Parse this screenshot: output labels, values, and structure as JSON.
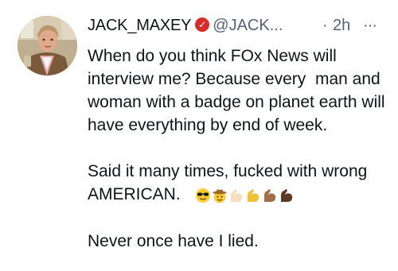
{
  "tweet": {
    "display_name": "JACK_MAXEY",
    "badge_glyph": "✓",
    "handle": "@JACK...",
    "dot": "·",
    "time": "2h",
    "more": "···",
    "paragraph_1": "When do you think FOx News will interview me? Because every  man and woman with a badge on planet earth will have everything by end of week.",
    "paragraph_2": "Said it many times, fucked with wrong AMERICAN.",
    "paragraph_3": "Never once have I lied.",
    "emojis": [
      "smiling-face-with-sunglasses",
      "cowboy-hat-face",
      "flexed-biceps-light",
      "flexed-biceps-medium",
      "flexed-biceps-medium-dark",
      "flexed-biceps-dark"
    ]
  },
  "colors": {
    "text": "#0f1419",
    "secondary": "#536471",
    "badge": "#d72c27",
    "background": "#ffffff"
  }
}
